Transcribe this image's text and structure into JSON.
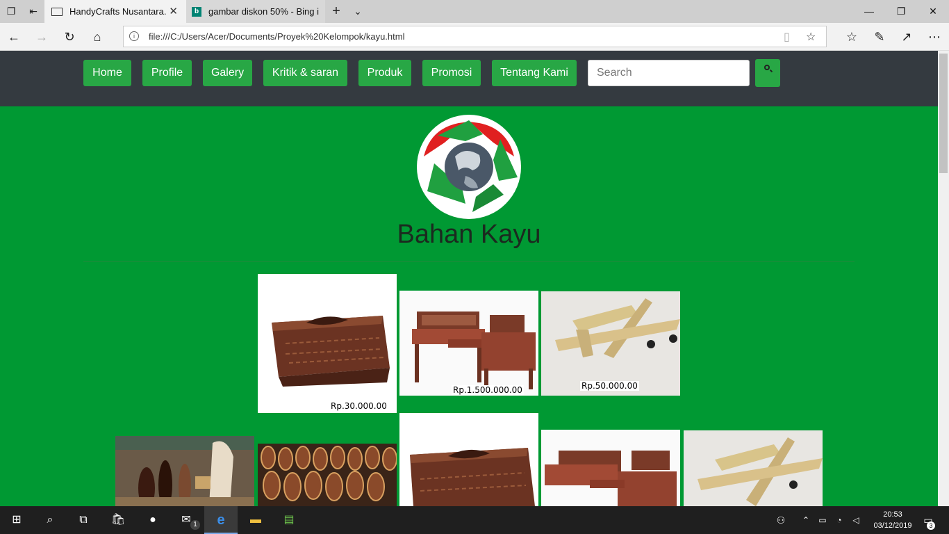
{
  "browser": {
    "tabs": [
      {
        "title": "HandyCrafts Nusantara."
      },
      {
        "title": "gambar diskon 50% - Bing i"
      }
    ],
    "url": "file:///C:/Users/Acer/Documents/Proyek%20Kelompok/kayu.html"
  },
  "nav": {
    "items": [
      "Home",
      "Profile",
      "Galery",
      "Kritik & saran",
      "Produk",
      "Promosi",
      "Tentang Kami"
    ],
    "search_placeholder": "Search"
  },
  "page": {
    "title": "Bahan Kayu"
  },
  "products": {
    "prices": [
      "Rp.30.000.00",
      "Rp.1.500.000.00",
      "Rp.50.000.00"
    ]
  },
  "taskbar": {
    "time": "20:53",
    "date": "03/12/2019",
    "mail_badge": "1",
    "notif_badge": "3"
  },
  "colors": {
    "page_bg": "#009933",
    "navbar_bg": "#343a40",
    "button_bg": "#28a745"
  }
}
